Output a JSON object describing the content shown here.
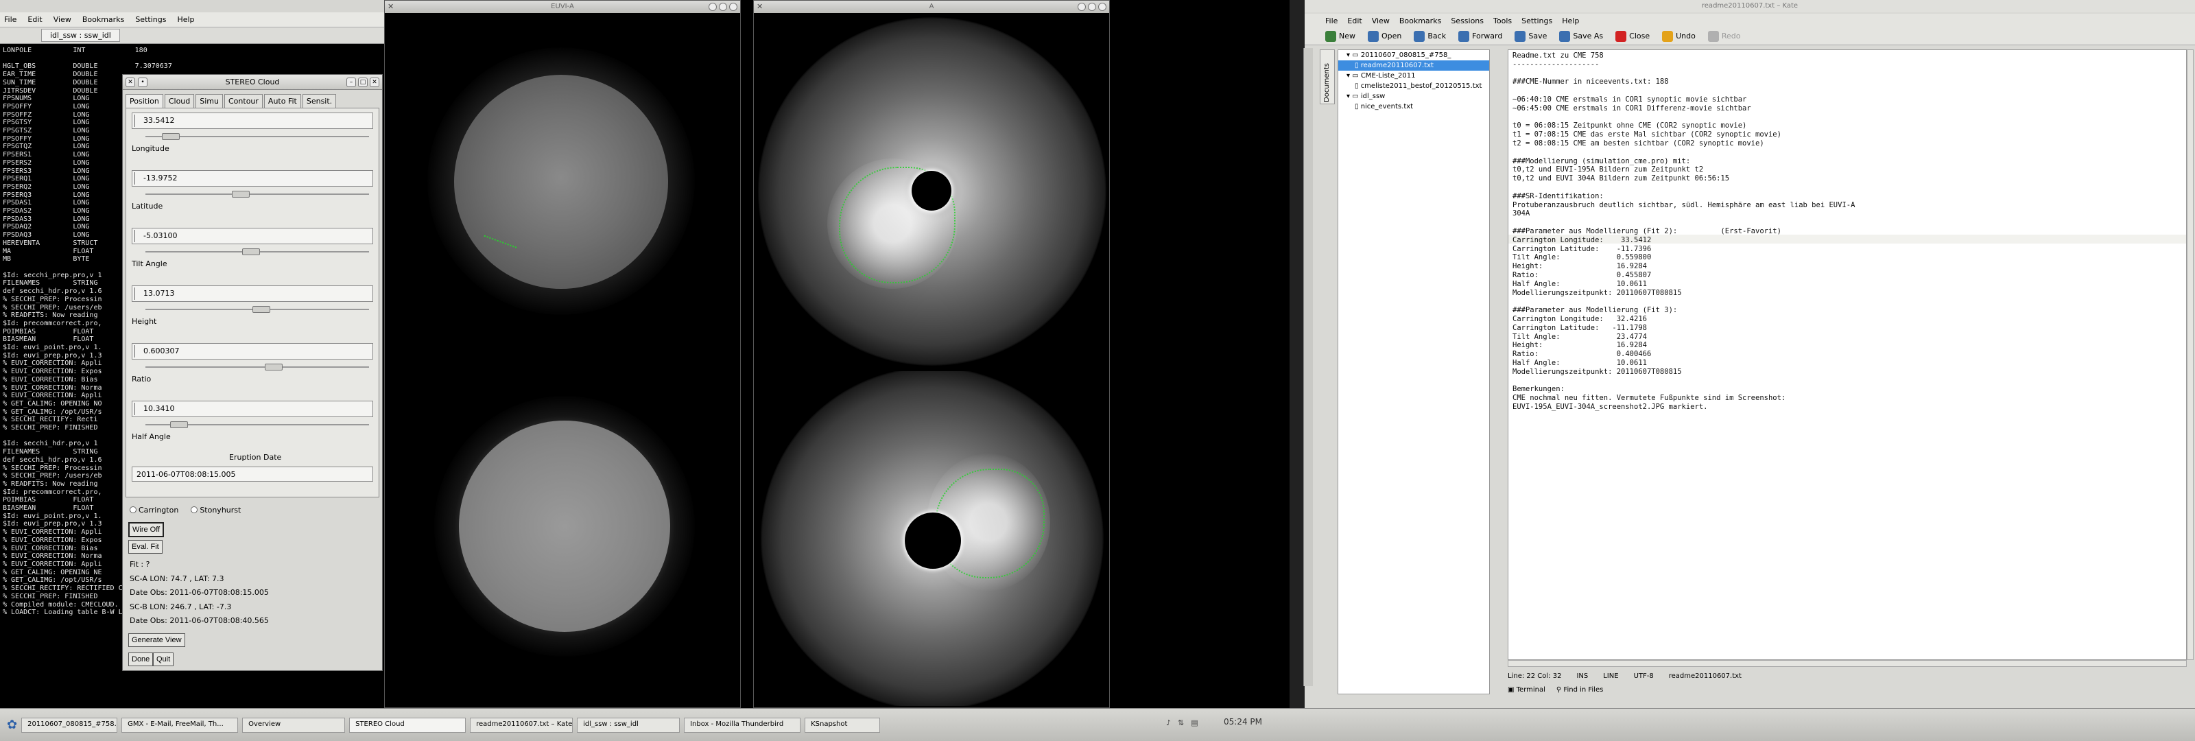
{
  "terminal": {
    "menu": [
      "File",
      "Edit",
      "View",
      "Bookmarks",
      "Settings",
      "Help"
    ],
    "tab_label": "idl_ssw : ssw_idl",
    "lines": [
      "LONPOLE          INT            180",
      "",
      "HGLT_OBS         DOUBLE         7.3070637",
      "EAR_TIME         DOUBLE",
      "SUN_TIME         DOUBLE",
      "JITRSDEV         DOUBLE",
      "FPSNUMS          LONG",
      "FPSOFFY          LONG",
      "FPSOFFZ          LONG",
      "FPSGTSY          LONG",
      "FPSGTSZ          LONG",
      "FPSOFFY          LONG",
      "FPSGTQZ          LONG",
      "FPSERS1          LONG",
      "FPSERS2          LONG",
      "FPSERS3          LONG",
      "FPSERQ1          LONG",
      "FPSERQ2          LONG",
      "FPSERQ3          LONG",
      "FPSDAS1          LONG",
      "FPSDAS2          LONG",
      "FPSDAS3          LONG",
      "FPSDAQ2          LONG",
      "FPSDAQ3          LONG",
      "HEREVENTA        STRUCT",
      "MA               FLOAT",
      "MB               BYTE",
      "",
      "$Id: secchi_prep.pro,v 1",
      "FILENAMES        STRING",
      "def secchi_hdr.pro,v 1.6",
      "% SECCHI_PREP: Processin",
      "% SECCHI_PREP: /users/eb",
      "% READFITS: Now reading",
      "$Id: precommcorrect.pro,",
      "POIMBIAS         FLOAT",
      "BIASMEAN         FLOAT",
      "$Id: euvi_point.pro,v 1.",
      "$Id: euvi_prep.pro,v 1.3",
      "% EUVI_CORRECTION: Appli",
      "% EUVI_CORRECTION: Expos",
      "% EUVI_CORRECTION: Bias",
      "% EUVI_CORRECTION: Norma",
      "% EUVI_CORRECTION: Appli",
      "% GET_CALIMG: OPENING NO",
      "% GET_CALIMG: /opt/USR/s",
      "% SECCHI_RECTIFY: Recti",
      "% SECCHI_PREP: FINISHED",
      "",
      "$Id: secchi_hdr.pro,v 1",
      "FILENAMES        STRING",
      "def secchi_hdr.pro,v 1.6",
      "% SECCHI_PREP: Processin",
      "% SECCHI_PREP: /users/eb",
      "% READFITS: Now reading",
      "$Id: precommcorrect.pro,",
      "POIMBIAS         FLOAT",
      "BIASMEAN         FLOAT",
      "$Id: euvi_point.pro,v 1.",
      "$Id: euvi_prep.pro,v 1.3",
      "% EUVI_CORRECTION: Appli",
      "% EUVI_CORRECTION: Expos",
      "% EUVI_CORRECTION: Bias",
      "% EUVI_CORRECTION: Norma",
      "% EUVI_CORRECTION: Appli",
      "% GET_CALIMG: OPENING NE",
      "% GET_CALIMG: /opt/USR/s",
      "% SECCHI_RECTIFY: RECTIFIED CALIBRATION IMAGE",
      "% SECCHI_PREP: FINISHED",
      "% Compiled module: CMECLOUD.",
      "% LOADCT: Loading table B-W LINEAR"
    ]
  },
  "stereo_cloud": {
    "title": "STEREO Cloud",
    "tabs": [
      "Position",
      "Cloud",
      "Simu",
      "Contour",
      "Auto Fit",
      "Sensit."
    ],
    "fields": [
      {
        "value": "33.5412",
        "label": "Longitude",
        "knob": 0.08
      },
      {
        "value": "-13.9752",
        "label": "Latitude",
        "knob": 0.42
      },
      {
        "value": "-5.03100",
        "label": "Tilt Angle",
        "knob": 0.47
      },
      {
        "value": "13.0713",
        "label": "Height",
        "knob": 0.52
      },
      {
        "value": "0.600307",
        "label": "Ratio",
        "knob": 0.58
      },
      {
        "value": "10.3410",
        "label": "Half Angle",
        "knob": 0.12
      }
    ],
    "eruption_label": "Eruption Date",
    "eruption_value": "2011-06-07T08:08:15.005",
    "radio": [
      "Carrington",
      "Stonyhurst"
    ],
    "wire_button": "Wire Off",
    "evalfit_button": "Eval. Fit",
    "info": [
      "Fit : ?",
      "SC-A LON:   74.7  , LAT:   7.3",
      "Date Obs: 2011-06-07T08:08:15.005",
      "SC-B LON:  246.7  , LAT:   -7.3",
      "Date Obs: 2011-06-07T08:08:40.565"
    ],
    "genview_button": "Generate View",
    "done_button": "Done",
    "quit_button": "Quit"
  },
  "euvi_window": {
    "title": "EUVI-A"
  },
  "cor_window": {
    "title": "A"
  },
  "kate": {
    "title": "readme20110607.txt – Kate",
    "menu": [
      "File",
      "Edit",
      "View",
      "Bookmarks",
      "Sessions",
      "Tools",
      "Settings",
      "Help"
    ],
    "toolbar": [
      {
        "label": "New",
        "color": "#3a7f3a",
        "disabled": false
      },
      {
        "label": "Open",
        "color": "#3b6fb0",
        "disabled": false
      },
      {
        "label": "Back",
        "color": "#3b6fb0",
        "disabled": false
      },
      {
        "label": "Forward",
        "color": "#3b6fb0",
        "disabled": false
      },
      {
        "label": "Save",
        "color": "#3b6fb0",
        "disabled": false
      },
      {
        "label": "Save As",
        "color": "#3b6fb0",
        "disabled": false
      },
      {
        "label": "Close",
        "color": "#d22222",
        "disabled": false
      },
      {
        "label": "Undo",
        "color": "#e3a21a",
        "disabled": false
      },
      {
        "label": "Redo",
        "color": "#b0b0b0",
        "disabled": true
      }
    ],
    "side_tab": "Documents",
    "tree": [
      {
        "text": "20110607_080815_#758_",
        "indent": 1,
        "selected": false
      },
      {
        "text": "readme20110607.txt",
        "indent": 2,
        "selected": true
      },
      {
        "text": "CME-Liste_2011",
        "indent": 1,
        "selected": false
      },
      {
        "text": "cmeliste2011_bestof_20120515.txt",
        "indent": 2,
        "selected": false
      },
      {
        "text": "idl_ssw",
        "indent": 1,
        "selected": false
      },
      {
        "text": "nice_events.txt",
        "indent": 2,
        "selected": false
      }
    ],
    "editor_lines": [
      "Readme.txt zu CME 758",
      "--------------------",
      "",
      "###CME-Nummer in niceevents.txt: 188",
      "",
      "~06:40:10 CME erstmals in COR1 synoptic movie sichtbar",
      "~06:45:00 CME erstmals in COR1 Differenz-movie sichtbar",
      "",
      "t0 = 06:08:15 Zeitpunkt ohne CME (COR2 synoptic movie)",
      "t1 = 07:08:15 CME das erste Mal sichtbar (COR2 synoptic movie)",
      "t2 = 08:08:15 CME am besten sichtbar (COR2 synoptic movie)",
      "",
      "###Modellierung (simulation_cme.pro) mit:",
      "t0,t2 und EUVI-195A Bildern zum Zeitpunkt t2",
      "t0,t2 und EUVI 304A Bildern zum Zeitpunkt 06:56:15",
      "",
      "###SR-Identifikation:",
      "Protuberanzausbruch deutlich sichtbar, südl. Hemisphäre am east liab bei EUVI-A",
      "304A",
      "",
      "###Parameter aus Modellierung (Fit 2):          (Erst-Favorit)",
      "Carrington Longitude:    33.5412",
      "Carrington Latitude:    -11.7396",
      "Tilt Angle:             0.559800",
      "Height:                 16.9284",
      "Ratio:                  0.455807",
      "Half Angle:             10.0611",
      "Modellierungszeitpunkt: 20110607T080815",
      "",
      "###Parameter aus Modellierung (Fit 3):",
      "Carrington Longitude:   32.4216",
      "Carrington Latitude:   -11.1798",
      "Tilt Angle:             23.4774",
      "Height:                 16.9284",
      "Ratio:                  0.400466",
      "Half Angle:             10.0611",
      "Modellierungszeitpunkt: 20110607T080815",
      "",
      "Bemerkungen:",
      "CME nochmal neu fitten. Vermutete Fußpunkte sind im Screenshot:",
      "EUVI-195A_EUVI-304A_screenshot2.JPG markiert."
    ],
    "status": [
      "Line: 22 Col: 32",
      "INS",
      "LINE",
      "UTF-8",
      "readme20110607.txt"
    ],
    "bottom_tabs": [
      "Terminal",
      "Find in Files"
    ]
  },
  "taskbar": {
    "tasks": [
      "20110607_080815_#758...",
      "GMX - E-Mail, FreeMail, Th...",
      "Overview",
      "STEREO Cloud",
      "readme20110607.txt – Kate",
      "idl_ssw : ssw_idl",
      "Inbox - Mozilla Thunderbird",
      "KSnapshot"
    ],
    "active_task": 3,
    "clock": "05:24 PM"
  }
}
